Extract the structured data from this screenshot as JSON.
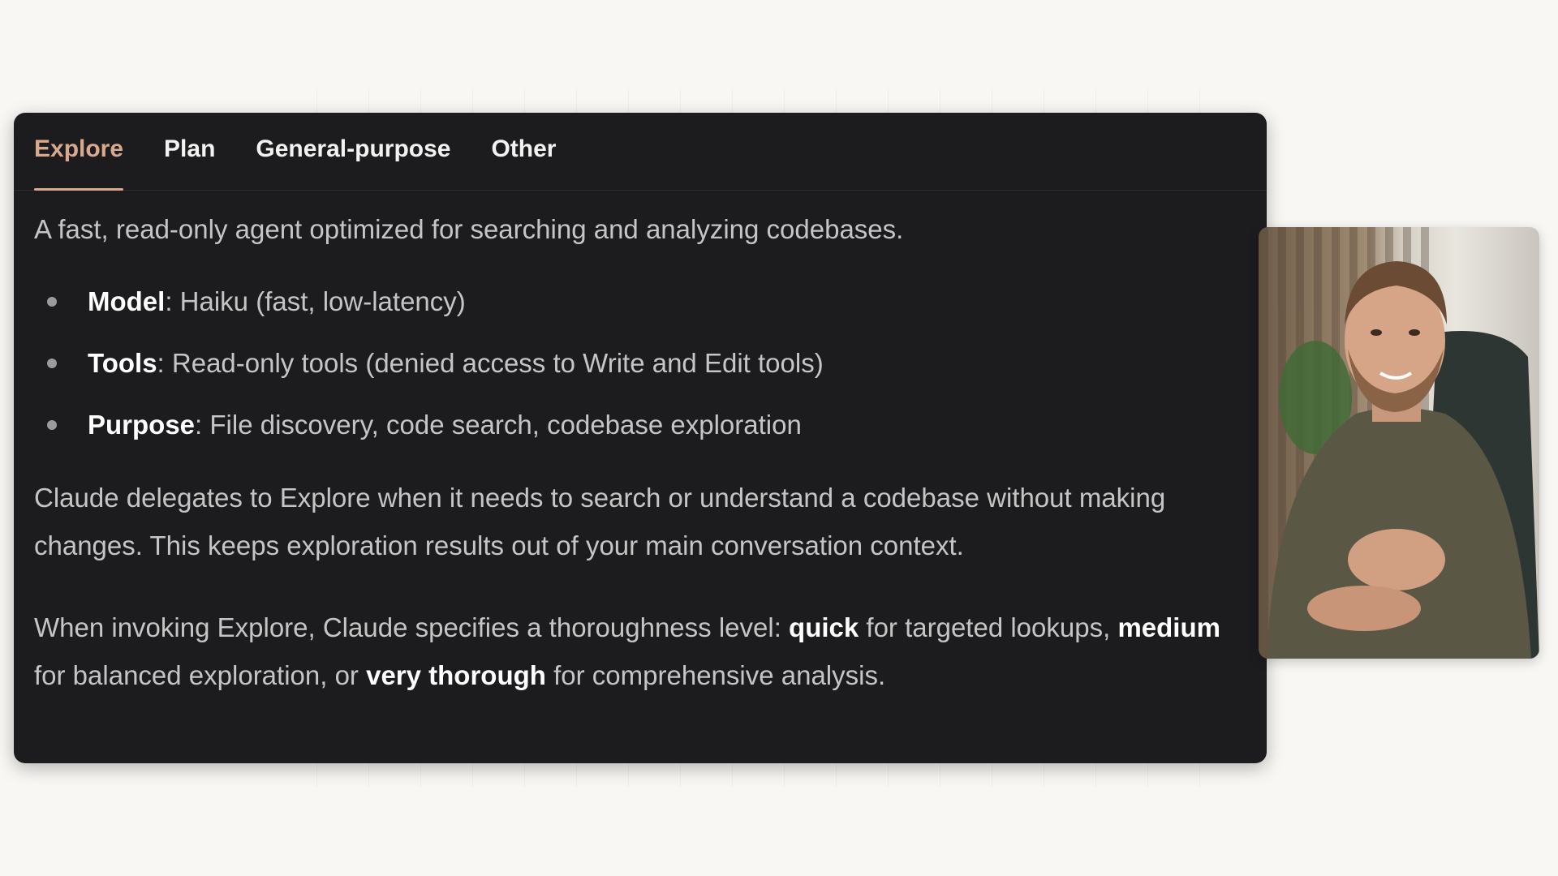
{
  "tabs": [
    {
      "label": "Explore",
      "active": true
    },
    {
      "label": "Plan",
      "active": false
    },
    {
      "label": "General-purpose",
      "active": false
    },
    {
      "label": "Other",
      "active": false
    }
  ],
  "intro": "A fast, read-only agent optimized for searching and analyzing codebases.",
  "bullets": [
    {
      "term": "Model",
      "desc": ": Haiku (fast, low-latency)"
    },
    {
      "term": "Tools",
      "desc": ": Read-only tools (denied access to Write and Edit tools)"
    },
    {
      "term": "Purpose",
      "desc": ": File discovery, code search, codebase exploration"
    }
  ],
  "delegation": "Claude delegates to Explore when it needs to search or understand a codebase without making changes. This keeps exploration results out of your main conversation context.",
  "thoroughness": {
    "prefix": "When invoking Explore, Claude specifies a thoroughness level: ",
    "quick": "quick",
    "after_quick": " for targeted lookups, ",
    "medium": "medium",
    "after_medium": " for balanced exploration, or ",
    "very_thorough": "very thorough",
    "after_very_thorough": " for comprehensive analysis."
  },
  "colors": {
    "page_bg": "#f8f7f4",
    "card_bg": "#1c1c1e",
    "accent": "#d9a98f",
    "body_text": "#c5c5c5",
    "bold_text": "#ffffff"
  },
  "webcam": {
    "icon": "person-video-feed"
  }
}
